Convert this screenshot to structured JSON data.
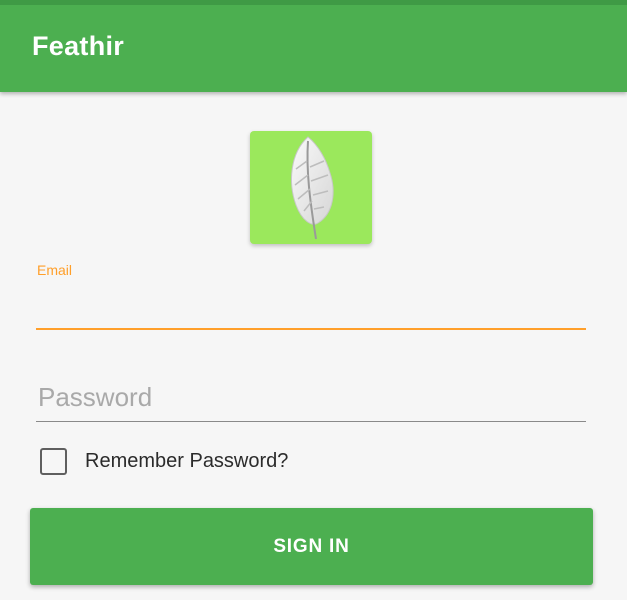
{
  "app_bar": {
    "title": "Feathir",
    "color": "#4caf50"
  },
  "logo": {
    "icon": "feather-icon",
    "tile_color": "#9be85c"
  },
  "form": {
    "email_label": "Email",
    "email_value": "",
    "email_focus_color": "#ff9f2a",
    "password_placeholder": "Password",
    "password_value": "",
    "remember_label": "Remember Password?",
    "remember_checked": false,
    "signin_label": "SIGN IN"
  }
}
